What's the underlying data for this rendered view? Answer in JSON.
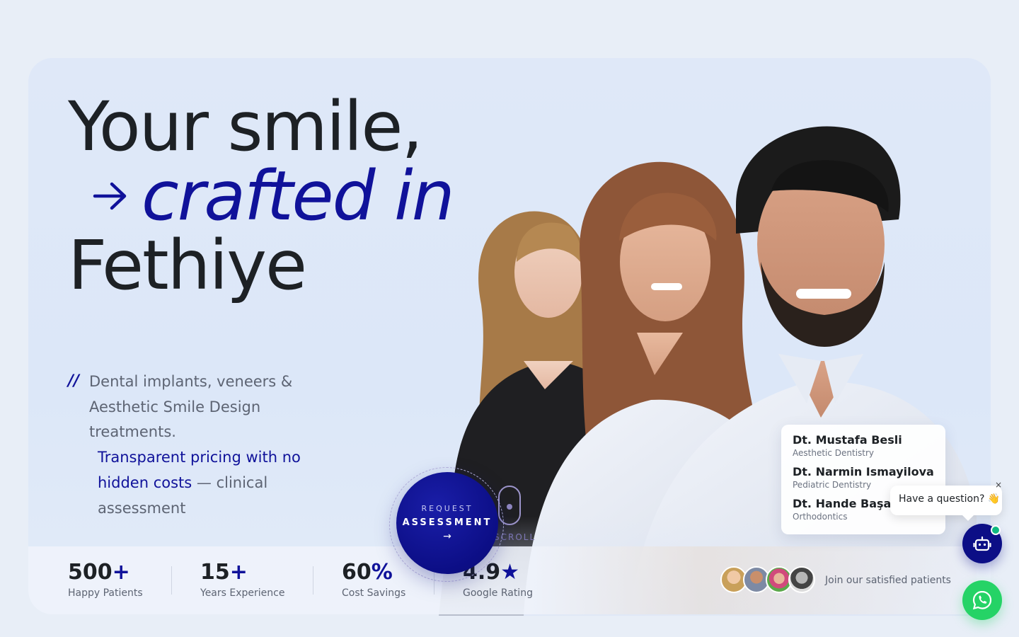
{
  "hero": {
    "line1": "Your smile,",
    "line2": "crafted in",
    "line3": "Fethiye"
  },
  "description": {
    "slash": "//",
    "text1": "Dental implants, veneers & Aesthetic Smile Design treatments.",
    "highlight": "Transparent pricing with no hidden costs",
    "text2": " — clinical assessment"
  },
  "cta": {
    "small": "REQUEST",
    "big": "ASSESSMENT",
    "arrow": "→"
  },
  "scroll": {
    "label": "SCROLL"
  },
  "stats": [
    {
      "value": "500",
      "suffix": "+",
      "label": "Happy Patients"
    },
    {
      "value": "15",
      "suffix": "+",
      "label": "Years Experience"
    },
    {
      "value": "60",
      "suffix": "%",
      "label": "Cost Savings"
    },
    {
      "value": "4.9",
      "suffix": "★",
      "label": "Google Rating"
    }
  ],
  "social_proof": {
    "text": "Join our satisfied patients"
  },
  "doctors": [
    {
      "name": "Dt. Mustafa Besli",
      "specialty": "Aesthetic Dentistry"
    },
    {
      "name": "Dt. Narmin Ismayilova",
      "specialty": "Pediatric Dentistry"
    },
    {
      "name": "Dt. Hande Başa",
      "specialty": "Orthodontics"
    }
  ],
  "chat": {
    "question": "Have a question? 👋",
    "close": "×"
  },
  "colors": {
    "accent": "#10129a",
    "whatsapp": "#25d366",
    "online": "#10b981"
  },
  "icons": [
    "arrow-right-icon",
    "robot-icon",
    "whatsapp-icon",
    "close-icon"
  ]
}
